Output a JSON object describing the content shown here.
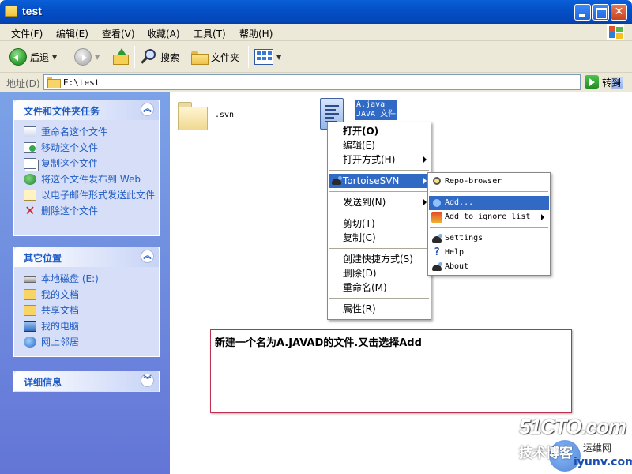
{
  "window": {
    "title": "test"
  },
  "menubar": {
    "items": [
      "文件(F)",
      "编辑(E)",
      "查看(V)",
      "收藏(A)",
      "工具(T)",
      "帮助(H)"
    ]
  },
  "toolbar": {
    "back_label": "后退",
    "search_label": "搜索",
    "folders_label": "文件夹"
  },
  "address": {
    "label": "地址(D)",
    "path": "E:\\test",
    "go_label": "转到"
  },
  "tasks_panel": {
    "title": "文件和文件夹任务",
    "items": [
      "重命名这个文件",
      "移动这个文件",
      "复制这个文件",
      "将这个文件发布到 Web",
      "以电子邮件形式发送此文件",
      "删除这个文件"
    ]
  },
  "places_panel": {
    "title": "其它位置",
    "items": [
      "本地磁盘 (E:)",
      "我的文档",
      "共享文档",
      "我的电脑",
      "网上邻居"
    ]
  },
  "details_panel": {
    "title": "详细信息"
  },
  "files": {
    "folder_name": ".svn",
    "selected_line1": "A.java",
    "selected_line2": "JAVA 文件"
  },
  "context_menu": {
    "items": [
      "打开(O)",
      "编辑(E)",
      "打开方式(H)",
      "TortoiseSVN",
      "发送到(N)",
      "剪切(T)",
      "复制(C)",
      "创建快捷方式(S)",
      "删除(D)",
      "重命名(M)",
      "属性(R)"
    ]
  },
  "svn_menu": {
    "items": [
      "Repo-browser",
      "Add...",
      "Add to ignore list",
      "Settings",
      "Help",
      "About"
    ]
  },
  "annotation": "新建一个名为A.JAVAD的文件.又击选择Add",
  "watermark": {
    "brand": "51CTO.com",
    "line2": "技术博客",
    "line3": "运维网",
    "url": "iyunv.com"
  },
  "colors": {
    "titlebar": "#0550c8",
    "selection": "#316ac5",
    "task_link": "#215dc6",
    "pane": "#6f8be0"
  }
}
